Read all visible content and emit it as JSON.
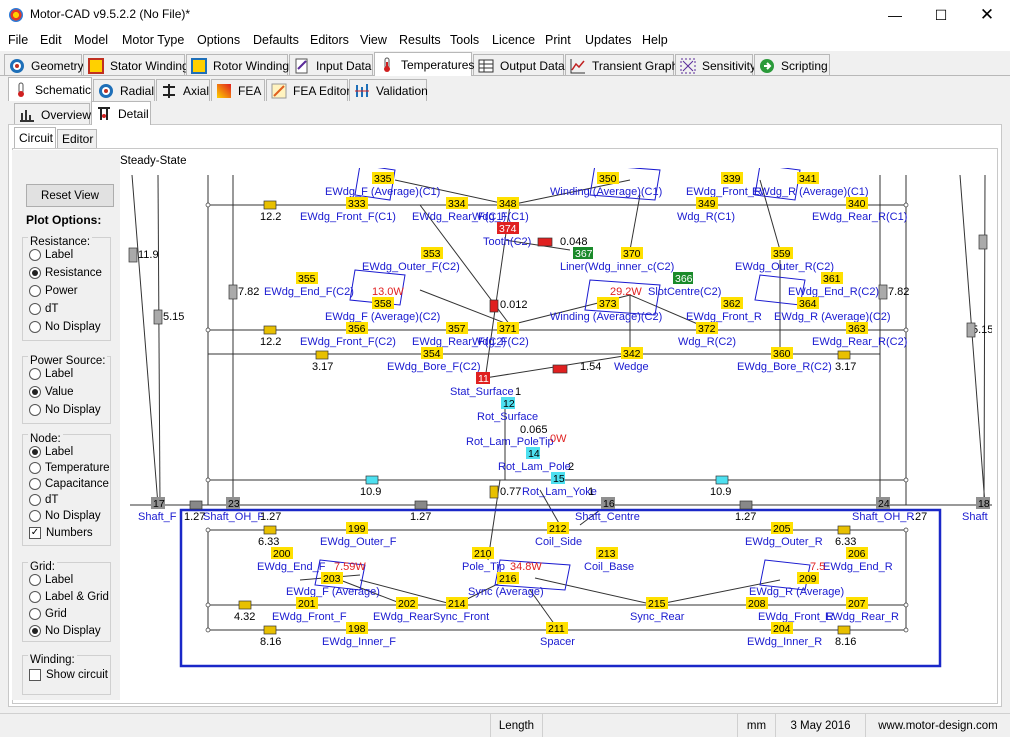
{
  "window": {
    "title": "Motor-CAD v9.5.2.2 (No File)*"
  },
  "menu": [
    "File",
    "Edit",
    "Model",
    "Motor Type",
    "Options",
    "Defaults",
    "Editors",
    "View",
    "Results",
    "Tools",
    "Licence",
    "Print",
    "Updates",
    "Help"
  ],
  "main_tabs": [
    {
      "label": "Geometry",
      "icon": "geometry-icon"
    },
    {
      "label": "Stator Winding",
      "icon": "stator-winding-icon"
    },
    {
      "label": "Rotor Winding",
      "icon": "rotor-winding-icon"
    },
    {
      "label": "Input Data",
      "icon": "input-data-icon"
    },
    {
      "label": "Temperatures",
      "icon": "thermometer-icon"
    },
    {
      "label": "Output Data",
      "icon": "table-icon"
    },
    {
      "label": "Transient Graph",
      "icon": "graph-icon"
    },
    {
      "label": "Sensitivity",
      "icon": "sensitivity-icon"
    },
    {
      "label": "Scripting",
      "icon": "scripting-icon"
    }
  ],
  "sub_tabs": [
    {
      "label": "Schematic",
      "icon": "schematic-icon"
    },
    {
      "label": "Radial",
      "icon": "radial-icon"
    },
    {
      "label": "Axial",
      "icon": "axial-icon"
    },
    {
      "label": "FEA",
      "icon": "fea-icon"
    },
    {
      "label": "FEA Editor",
      "icon": "fea-editor-icon"
    },
    {
      "label": "Validation",
      "icon": "validation-icon"
    }
  ],
  "view_tabs": [
    {
      "label": "Overview",
      "icon": "overview-icon"
    },
    {
      "label": "Detail",
      "icon": "detail-icon"
    }
  ],
  "circuit_tabs": [
    "Circuit",
    "Editor"
  ],
  "steady_state": "Steady-State",
  "reset_view": "Reset View",
  "plot_options": "Plot Options:",
  "groups": {
    "resistance": {
      "title": "Resistance:",
      "options": [
        "Label",
        "Resistance",
        "Power",
        "dT",
        "No Display"
      ],
      "selected": 1
    },
    "power": {
      "title": "Power Source:",
      "options": [
        "Label",
        "Value",
        "No Display"
      ],
      "selected": 1
    },
    "node": {
      "title": "Node:",
      "options": [
        "Label",
        "Temperature",
        "Capacitance",
        "dT",
        "No Display"
      ],
      "selected": 0,
      "numbers_label": "Numbers",
      "numbers_checked": true
    },
    "grid": {
      "title": "Grid:",
      "options": [
        "Label",
        "Label & Grid",
        "Grid",
        "No Display"
      ],
      "selected": 3
    },
    "winding": {
      "title": "Winding:",
      "show_label": "Show circuit",
      "show_checked": false
    }
  },
  "status": {
    "field": "Length",
    "unit": "mm",
    "date": "3 May 2016",
    "website": "www.motor-design.com"
  },
  "diagram": {
    "blue_labels": [
      "EWdg_F (Average)(C1)",
      "EWdg_Front_F(C1)",
      "EWdg_Rear_F(C1)",
      "Winding (Average)(C1)",
      "EWdg_Front_R",
      "EWdg_R (Average)(C1)",
      "Wdg_R(C1)",
      "EWdg_Rear_R(C1)",
      "Wdg_F(C1)",
      "Tooth(C2)",
      "Liner(Wdg_inner_c(C2)",
      "EWdg_Outer_F(C2)",
      "EWdg_Outer_R(C2)",
      "EWdg_End_F(C2)",
      "EWdg_End_R(C2)",
      "SlotCentre(C2)",
      "EWdg_F (Average)(C2)",
      "Winding (Average)(C2)",
      "EWdg_R (Average)(C2)",
      "EWdg_Front_F(C2)",
      "EWdg_Rear_F(C2)",
      "Wdg_F(C2)",
      "Wdg_R(C2)",
      "EWdg_Front_R",
      "EWdg_Rear_R(C2)",
      "EWdg_Bore_F(C2)",
      "Wedge",
      "EWdg_Bore_R(C2)",
      "Stat_Surface",
      "Rot_Surface",
      "Rot_Lam_PoleTip",
      "Rot_Lam_Pole",
      "Rot_Lam_Yoke",
      "Shaft_F",
      "Shaft_OH_F",
      "Shaft_Centre",
      "Shaft_OH_R",
      "Shaft",
      "EWdg_Outer_F",
      "Coil_Side",
      "EWdg_Outer_R",
      "EWdg_End_F",
      "Pole_Tip",
      "Coil_Base",
      "EWdg_End_R",
      "EWdg_F (Average)",
      "Sync (Average)",
      "EWdg_R (Average)",
      "EWdg_Front_F",
      "EWdg_RearSync_Front",
      "Sync_Rear",
      "EWdg_Front_R",
      "EWdg_Rear_R",
      "EWdg_Inner_F",
      "Spacer",
      "EWdg_Inner_R"
    ],
    "yellow_nodes": [
      "335",
      "350",
      "339",
      "341",
      "333",
      "334",
      "348",
      "349",
      "340",
      "374",
      "353",
      "370",
      "359",
      "355",
      "358",
      "373",
      "361",
      "362",
      "364",
      "356",
      "357",
      "371",
      "372",
      "363",
      "354",
      "342",
      "360",
      "199",
      "205",
      "200",
      "210",
      "212",
      "213",
      "206",
      "203",
      "216",
      "209",
      "201",
      "202",
      "214",
      "215",
      "208",
      "207",
      "198",
      "211",
      "204"
    ],
    "red_nodes": [
      "374",
      "11"
    ],
    "cyan_nodes": [
      "12",
      "14",
      "15"
    ],
    "green_nodes": [
      "367",
      "366"
    ],
    "gray_nodes": [
      "17",
      "23",
      "16",
      "24",
      "18"
    ],
    "values": [
      "12.2",
      "0.048",
      "7.82",
      "0.012",
      "12.2",
      "3.17",
      "1.54",
      "3.17",
      "11.9",
      "5.15",
      "7.82",
      "1",
      "0.065",
      "2",
      "10.9",
      "10.9",
      "0.77",
      "1",
      "1.27",
      "1.27",
      "1.27",
      "1.27",
      ".27",
      "6.33",
      "6.33",
      "4.32",
      "8.16",
      "8.16",
      "5.15"
    ],
    "power": [
      "13.0W",
      "29.2W",
      "7.59W",
      "34.8W",
      "7.5",
      "0W"
    ]
  }
}
